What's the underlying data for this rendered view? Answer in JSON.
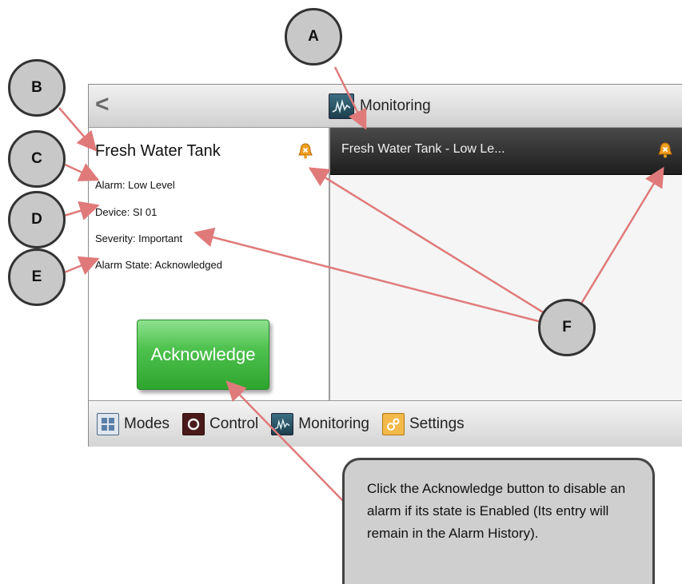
{
  "titlebar": {
    "back": "<",
    "title": "Monitoring"
  },
  "alarm_detail": {
    "name": "Fresh Water Tank",
    "alarm": "Alarm: Low Level",
    "device": "Device: SI 01",
    "severity": "Severity: Important",
    "state": "Alarm State: Acknowledged",
    "ack_button": "Acknowledge"
  },
  "alarm_list": [
    {
      "label": "Fresh Water Tank - Low Le..."
    }
  ],
  "nav": [
    {
      "label": "Modes"
    },
    {
      "label": "Control"
    },
    {
      "label": "Monitoring"
    },
    {
      "label": "Settings"
    }
  ],
  "callouts": {
    "a": "A",
    "b": "B",
    "c": "C",
    "d": "D",
    "e": "E",
    "f": "F"
  },
  "note": "Click the Acknowledge button to disable an alarm if its state is Enabled (Its entry will remain in the Alarm History).",
  "colors": {
    "alarm_bell": "#f0a020",
    "ack_green": "#3cb43c",
    "annotation_arrow": "#e07a7a"
  }
}
